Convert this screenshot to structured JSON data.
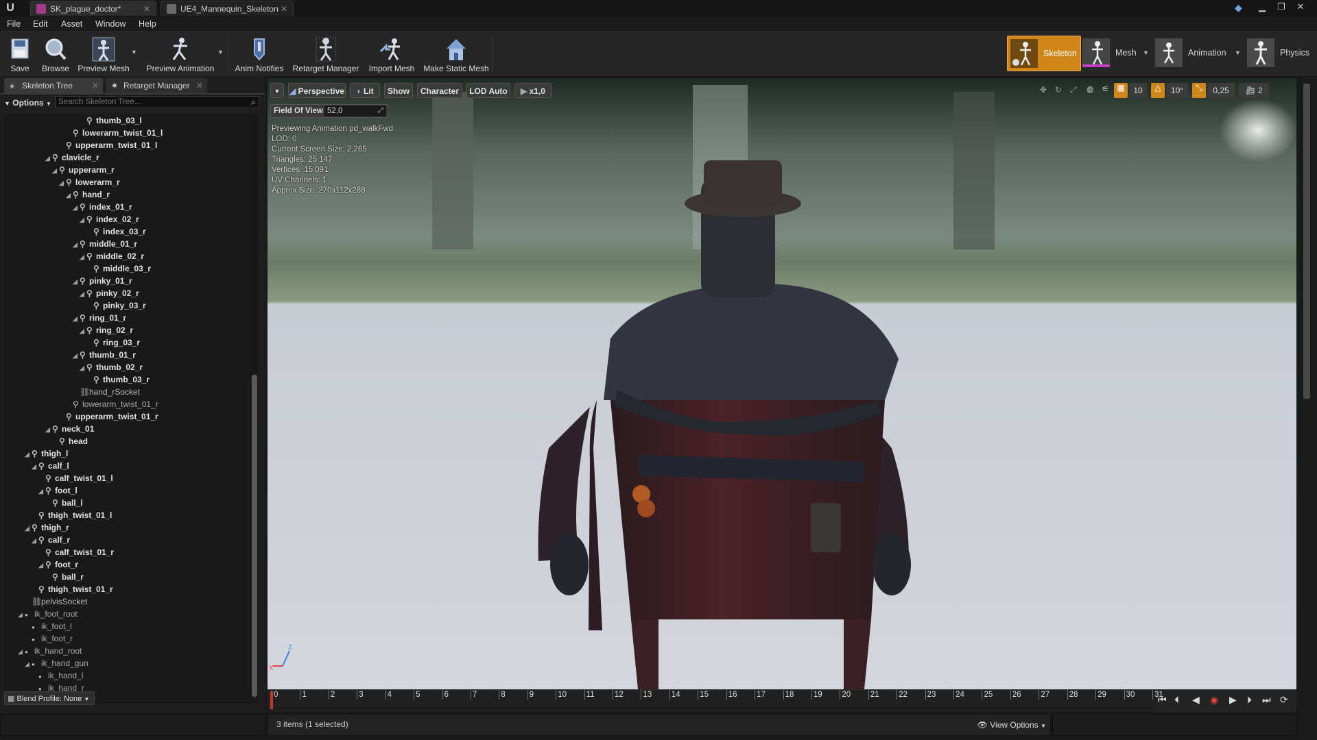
{
  "title_tabs": [
    {
      "label": "SK_plague_doctor*"
    },
    {
      "label": "UE4_Mannequin_Skeleton"
    }
  ],
  "menu": [
    "File",
    "Edit",
    "Asset",
    "Window",
    "Help"
  ],
  "toolbar": {
    "save": "Save",
    "browse": "Browse",
    "preview_mesh": "Preview Mesh",
    "preview_animation": "Preview Animation",
    "anim_notifies": "Anim Notifies",
    "retarget_manager": "Retarget Manager",
    "import_mesh": "Import Mesh",
    "make_static_mesh": "Make Static Mesh"
  },
  "modes": {
    "skeleton": "Skeleton",
    "mesh": "Mesh",
    "animation": "Animation",
    "physics": "Physics"
  },
  "left_panel": {
    "tab_skeleton_tree": "Skeleton Tree",
    "tab_retarget_manager": "Retarget Manager",
    "options": "Options",
    "search_placeholder": "Search Skeleton Tree...",
    "blend_profile": "Blend Profile: None"
  },
  "bones": [
    {
      "name": "thumb_03_l",
      "depth": 12,
      "type": "bone",
      "expanded": null
    },
    {
      "name": "lowerarm_twist_01_l",
      "depth": 10,
      "type": "bone",
      "expanded": null
    },
    {
      "name": "upperarm_twist_01_l",
      "depth": 9,
      "type": "bone",
      "expanded": null
    },
    {
      "name": "clavicle_r",
      "depth": 7,
      "type": "bone",
      "expanded": true
    },
    {
      "name": "upperarm_r",
      "depth": 8,
      "type": "bone",
      "expanded": true
    },
    {
      "name": "lowerarm_r",
      "depth": 9,
      "type": "bone",
      "expanded": true
    },
    {
      "name": "hand_r",
      "depth": 10,
      "type": "bone",
      "expanded": true
    },
    {
      "name": "index_01_r",
      "depth": 11,
      "type": "bone",
      "expanded": true
    },
    {
      "name": "index_02_r",
      "depth": 12,
      "type": "bone",
      "expanded": true
    },
    {
      "name": "index_03_r",
      "depth": 13,
      "type": "bone",
      "expanded": null
    },
    {
      "name": "middle_01_r",
      "depth": 11,
      "type": "bone",
      "expanded": true
    },
    {
      "name": "middle_02_r",
      "depth": 12,
      "type": "bone",
      "expanded": true
    },
    {
      "name": "middle_03_r",
      "depth": 13,
      "type": "bone",
      "expanded": null
    },
    {
      "name": "pinky_01_r",
      "depth": 11,
      "type": "bone",
      "expanded": true
    },
    {
      "name": "pinky_02_r",
      "depth": 12,
      "type": "bone",
      "expanded": true
    },
    {
      "name": "pinky_03_r",
      "depth": 13,
      "type": "bone",
      "expanded": null
    },
    {
      "name": "ring_01_r",
      "depth": 11,
      "type": "bone",
      "expanded": true
    },
    {
      "name": "ring_02_r",
      "depth": 12,
      "type": "bone",
      "expanded": true
    },
    {
      "name": "ring_03_r",
      "depth": 13,
      "type": "bone",
      "expanded": null
    },
    {
      "name": "thumb_01_r",
      "depth": 11,
      "type": "bone",
      "expanded": true
    },
    {
      "name": "thumb_02_r",
      "depth": 12,
      "type": "bone",
      "expanded": true
    },
    {
      "name": "thumb_03_r",
      "depth": 13,
      "type": "bone",
      "expanded": null
    },
    {
      "name": "hand_rSocket",
      "depth": 11,
      "type": "socket",
      "expanded": null
    },
    {
      "name": "lowerarm_twist_01_r",
      "depth": 10,
      "type": "bone-plain",
      "expanded": null
    },
    {
      "name": "upperarm_twist_01_r",
      "depth": 9,
      "type": "bone",
      "expanded": null
    },
    {
      "name": "neck_01",
      "depth": 7,
      "type": "bone",
      "expanded": true
    },
    {
      "name": "head",
      "depth": 8,
      "type": "bone",
      "expanded": null
    },
    {
      "name": "thigh_l",
      "depth": 4,
      "type": "bone",
      "expanded": true
    },
    {
      "name": "calf_l",
      "depth": 5,
      "type": "bone",
      "expanded": true
    },
    {
      "name": "calf_twist_01_l",
      "depth": 6,
      "type": "bone",
      "expanded": null
    },
    {
      "name": "foot_l",
      "depth": 6,
      "type": "bone",
      "expanded": true
    },
    {
      "name": "ball_l",
      "depth": 7,
      "type": "bone",
      "expanded": null
    },
    {
      "name": "thigh_twist_01_l",
      "depth": 5,
      "type": "bone",
      "expanded": null
    },
    {
      "name": "thigh_r",
      "depth": 4,
      "type": "bone",
      "expanded": true
    },
    {
      "name": "calf_r",
      "depth": 5,
      "type": "bone",
      "expanded": true
    },
    {
      "name": "calf_twist_01_r",
      "depth": 6,
      "type": "bone",
      "expanded": null
    },
    {
      "name": "foot_r",
      "depth": 6,
      "type": "bone",
      "expanded": true
    },
    {
      "name": "ball_r",
      "depth": 7,
      "type": "bone",
      "expanded": null
    },
    {
      "name": "thigh_twist_01_r",
      "depth": 5,
      "type": "bone",
      "expanded": null
    },
    {
      "name": "pelvisSocket",
      "depth": 4,
      "type": "socket",
      "expanded": null
    },
    {
      "name": "ik_foot_root",
      "depth": 3,
      "type": "vbone",
      "expanded": true
    },
    {
      "name": "ik_foot_l",
      "depth": 4,
      "type": "vbone",
      "expanded": null
    },
    {
      "name": "ik_foot_r",
      "depth": 4,
      "type": "vbone",
      "expanded": null
    },
    {
      "name": "ik_hand_root",
      "depth": 3,
      "type": "vbone",
      "expanded": true
    },
    {
      "name": "ik_hand_gun",
      "depth": 4,
      "type": "vbone",
      "expanded": true
    },
    {
      "name": "ik_hand_l",
      "depth": 5,
      "type": "vbone",
      "expanded": null
    },
    {
      "name": "ik_hand_r",
      "depth": 5,
      "type": "vbone",
      "expanded": null
    }
  ],
  "viewport": {
    "perspective": "Perspective",
    "lit": "Lit",
    "show": "Show",
    "character": "Character",
    "lod": "LOD Auto",
    "play_rate": "x1,0",
    "fov_label": "Field Of View",
    "fov_value": "52,0",
    "grid_snap": "10",
    "rot_snap": "10°",
    "scale_snap": "0,25",
    "cam_speed": "2",
    "stats": [
      "Previewing Animation pd_walkFwd",
      "LOD: 0",
      "Current Screen Size: 2,265",
      "Triangles: 25 147",
      "Vertices: 15 091",
      "UV Channels: 1",
      "Approx Size: 270x112x288"
    ],
    "axis_z": "Z",
    "axis_x": "X"
  },
  "timeline": {
    "ticks": [
      "0",
      "1",
      "2",
      "3",
      "4",
      "5",
      "6",
      "7",
      "8",
      "9",
      "10",
      "11",
      "12",
      "13",
      "14",
      "15",
      "16",
      "17",
      "18",
      "19",
      "20",
      "21",
      "22",
      "23",
      "24",
      "25",
      "26",
      "27",
      "28",
      "29",
      "30",
      "31"
    ]
  },
  "status": {
    "items": "3 items (1 selected)",
    "view_options": "View Options"
  },
  "colors": {
    "accent_orange": "#e8981e",
    "selected_mode": "#d1861a"
  }
}
